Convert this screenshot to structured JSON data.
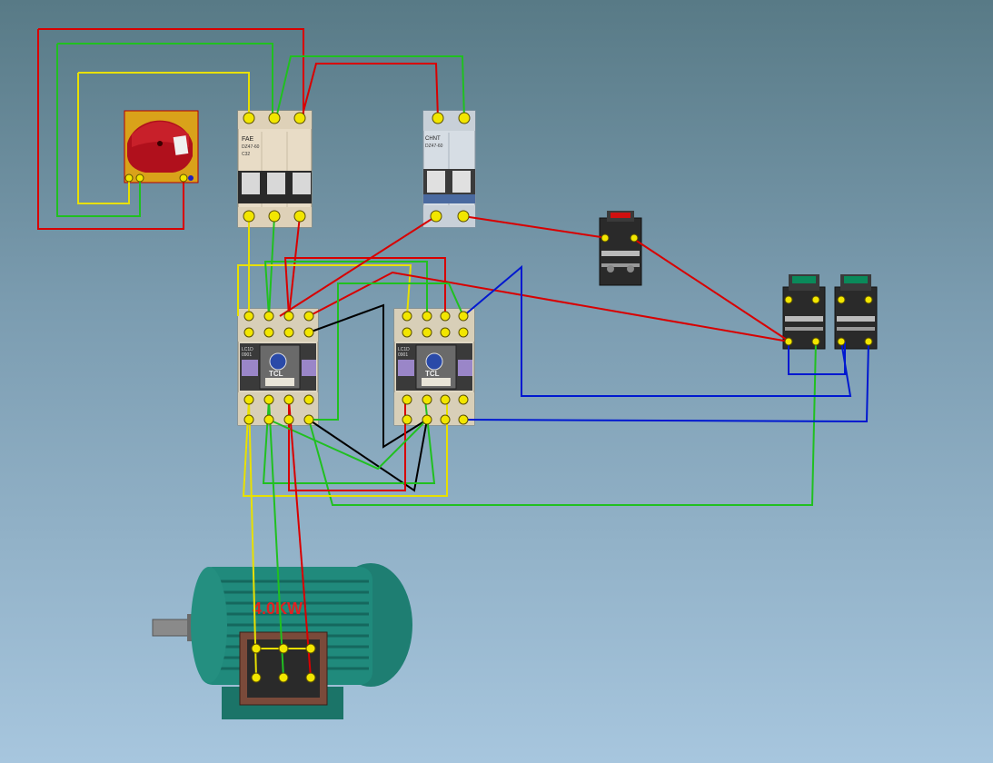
{
  "breaker3p": {
    "brand": "FAE",
    "model": "DZ47-60",
    "spec": "C32"
  },
  "breaker2p": {
    "brand": "CHNT",
    "model": "DZ47-60"
  },
  "contactor_left": {
    "brand": "TCL",
    "model": "LC1D",
    "code": "0901"
  },
  "contactor_right": {
    "brand": "TCL",
    "model": "LC1D",
    "code": "0901"
  },
  "motor": {
    "rating": "4.0KW"
  },
  "colors": {
    "wire_red": "#d80000",
    "wire_green": "#20c020",
    "wire_yellow": "#e8e000",
    "wire_blue": "#0018d0",
    "wire_black": "#000000",
    "terminal": "#f2e600",
    "isolator_body": "#d4a017",
    "isolator_knob": "#b0101c",
    "motor_body": "#1f8a7c"
  },
  "icons": [
    "rotary-isolator-icon",
    "circuit-breaker-icon",
    "contactor-icon",
    "push-button-icon",
    "motor-icon"
  ]
}
